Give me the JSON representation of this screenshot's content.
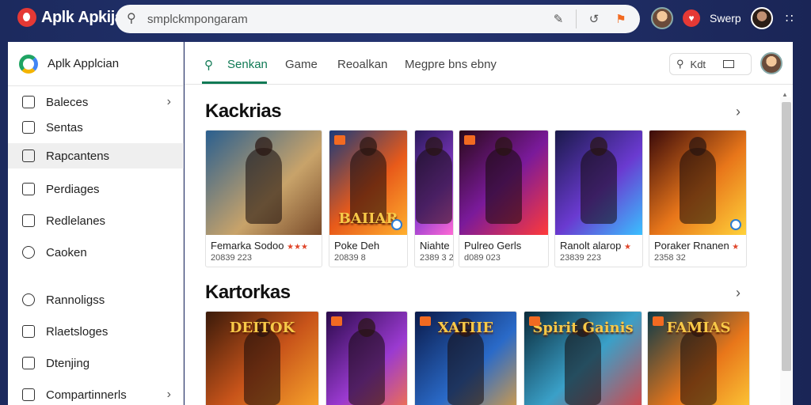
{
  "app": {
    "name": "Aplk Apkijal"
  },
  "search": {
    "placeholder": "smplckmpongaram",
    "value": "smplckmpongaram"
  },
  "topbar": {
    "user_label": "Swerp"
  },
  "sidebar": {
    "title": "Aplk Applcian",
    "items": [
      {
        "label": "Baleces",
        "icon": "doc-icon"
      },
      {
        "label": "Sentas",
        "icon": "file-icon"
      },
      {
        "label": "Rapcantens",
        "icon": "panel-icon"
      },
      {
        "label": "Perdiages",
        "icon": "tag-icon"
      },
      {
        "label": "Redlelanes",
        "icon": "puzzle-icon"
      },
      {
        "label": "Caoken",
        "icon": "circle-icon"
      },
      {
        "label": "Rannoligss",
        "icon": "settings-icon"
      },
      {
        "label": "Rlaetsloges",
        "icon": "list-icon"
      },
      {
        "label": "Dtenjing",
        "icon": "box-icon"
      },
      {
        "label": "Compartinnerls",
        "icon": "folder-icon"
      }
    ]
  },
  "tabs": [
    {
      "label": "Senkan"
    },
    {
      "label": "Game"
    },
    {
      "label": "Reoalkan"
    },
    {
      "label": "Megpre bns ebny"
    }
  ],
  "filter": {
    "label": "Kdt"
  },
  "sections": [
    {
      "title": "Kackrias",
      "cards": [
        {
          "name": "Femarka Sodoo",
          "stars": "★★★",
          "sub": "20839 223",
          "art": "desert-warrior",
          "banner": ""
        },
        {
          "name": "Poke Deh",
          "stars": "",
          "sub": "20839 8",
          "art": "fire-mage",
          "banner": "BAIIAR"
        },
        {
          "name": "Niahte",
          "stars": "",
          "sub": "2389 3 2",
          "art": "purple-fighter",
          "banner": ""
        },
        {
          "name": "Pulreo Gerls",
          "stars": "",
          "sub": "d089 023",
          "art": "red-knight",
          "banner": ""
        },
        {
          "name": "Ranolt alarop",
          "stars": "★",
          "sub": "23839 223",
          "art": "violet-sorcerer",
          "banner": ""
        },
        {
          "name": "Poraker Rnanen",
          "stars": "★",
          "sub": "2358 32",
          "art": "golden-hero",
          "banner": ""
        }
      ]
    },
    {
      "title": "Kartorkas",
      "cards": [
        {
          "name": "",
          "stars": "",
          "sub": "",
          "art": "deltok-arena",
          "banner": "DEITOK"
        },
        {
          "name": "",
          "stars": "",
          "sub": "",
          "art": "armored-brawler",
          "banner": ""
        },
        {
          "name": "",
          "stars": "",
          "sub": "",
          "art": "ninja-city",
          "banner": "XATIIE"
        },
        {
          "name": "",
          "stars": "",
          "sub": "",
          "art": "spirit-gaming",
          "banner": "Spirit Gainis"
        },
        {
          "name": "",
          "stars": "",
          "sub": "",
          "art": "green-warrior",
          "banner": "FAMIAS"
        }
      ]
    }
  ],
  "colors": {
    "accent": "#107a55",
    "header_bg": "#1c2a5e",
    "brand_red": "#e53935"
  }
}
